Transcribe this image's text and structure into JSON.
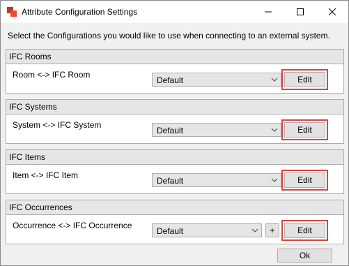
{
  "window": {
    "title": "Attribute Configuration Settings"
  },
  "intro": "Select the Configurations you would like to use when connecting to an external system.",
  "groups": [
    {
      "header": "IFC Rooms",
      "label": "Room <-> IFC Room",
      "selected": "Default",
      "edit_label": "Edit"
    },
    {
      "header": "IFC Systems",
      "label": "System <-> IFC System",
      "selected": "Default",
      "edit_label": "Edit"
    },
    {
      "header": "IFC Items",
      "label": "Item <-> IFC Item",
      "selected": "Default",
      "edit_label": "Edit"
    },
    {
      "header": "IFC Occurrences",
      "label": "Occurrence <-> IFC Occurrence",
      "selected": "Default",
      "edit_label": "Edit",
      "add_label": "+"
    }
  ],
  "ok_label": "Ok",
  "colors": {
    "highlight": "#d64545",
    "header_bg": "#e6e6e6",
    "window_bg": "#f0f0f0"
  },
  "icons": [
    "app-icon",
    "minimize-icon",
    "maximize-icon",
    "close-icon",
    "chevron-down-icon"
  ]
}
